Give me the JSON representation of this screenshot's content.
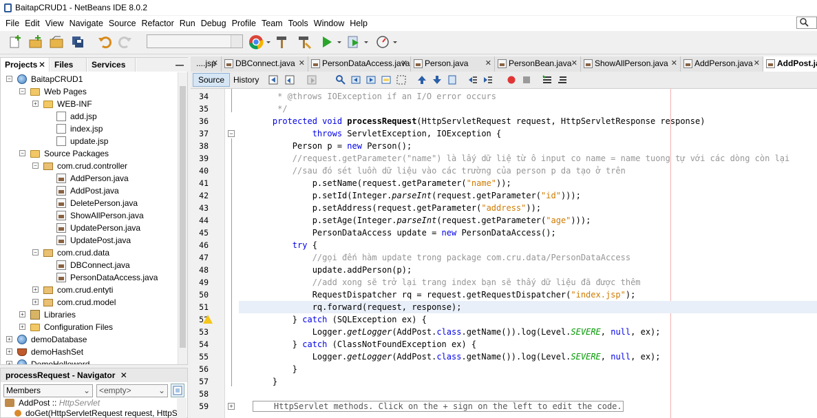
{
  "window": {
    "title": "BaitapCRUD1 - NetBeans IDE 8.0.2"
  },
  "menu": [
    "File",
    "Edit",
    "View",
    "Navigate",
    "Source",
    "Refactor",
    "Run",
    "Debug",
    "Profile",
    "Team",
    "Tools",
    "Window",
    "Help"
  ],
  "search": {
    "icon": "search-icon"
  },
  "panel_tabs": {
    "projects": "Projects",
    "files": "Files",
    "services": "Services",
    "minimize": "—",
    "close": "✕"
  },
  "tree": [
    {
      "label": "BaitapCRUD1",
      "icon": "globe-icon",
      "toggle": "−"
    },
    {
      "label": "Web Pages",
      "icon": "folder-icon",
      "toggle": "−"
    },
    {
      "label": "WEB-INF",
      "icon": "folder-icon",
      "toggle": "+"
    },
    {
      "label": "add.jsp",
      "icon": "jsp-icon",
      "toggle": ""
    },
    {
      "label": "index.jsp",
      "icon": "jsp-icon",
      "toggle": ""
    },
    {
      "label": "update.jsp",
      "icon": "jsp-icon",
      "toggle": ""
    },
    {
      "label": "Source Packages",
      "icon": "folder-icon",
      "toggle": "−"
    },
    {
      "label": "com.crud.controller",
      "icon": "package-icon",
      "toggle": "−"
    },
    {
      "label": "AddPerson.java",
      "icon": "java-icon",
      "toggle": ""
    },
    {
      "label": "AddPost.java",
      "icon": "java-icon",
      "toggle": ""
    },
    {
      "label": "DeletePerson.java",
      "icon": "java-icon",
      "toggle": ""
    },
    {
      "label": "ShowAllPerson.java",
      "icon": "java-icon",
      "toggle": ""
    },
    {
      "label": "UpdatePerson.java",
      "icon": "java-icon",
      "toggle": ""
    },
    {
      "label": "UpdatePost.java",
      "icon": "java-icon",
      "toggle": ""
    },
    {
      "label": "com.crud.data",
      "icon": "package-icon",
      "toggle": "−"
    },
    {
      "label": "DBConnect.java",
      "icon": "java-icon",
      "toggle": ""
    },
    {
      "label": "PersonDataAccess.java",
      "icon": "java-icon",
      "toggle": ""
    },
    {
      "label": "com.crud.entyti",
      "icon": "package-icon",
      "toggle": "+"
    },
    {
      "label": "com.crud.model",
      "icon": "package-icon",
      "toggle": "+"
    },
    {
      "label": "Libraries",
      "icon": "library-icon",
      "toggle": "+"
    },
    {
      "label": "Configuration Files",
      "icon": "folder-icon",
      "toggle": "+"
    },
    {
      "label": "demoDatabase",
      "icon": "globe-icon",
      "toggle": "+"
    },
    {
      "label": "demoHashSet",
      "icon": "coffee-cup-icon",
      "toggle": "+"
    },
    {
      "label": "DemoHelloword",
      "icon": "globe-icon",
      "toggle": "+"
    }
  ],
  "navigator": {
    "title": "processRequest - Navigator",
    "close": "✕",
    "members_select": "Members",
    "filter_select": "<empty>",
    "items": [
      {
        "name": "AddPost",
        "sep": " :: ",
        "type": "HttpServlet"
      },
      {
        "name": "doGet",
        "params": "(HttpServletRequest request, HttpSe"
      }
    ]
  },
  "editor_tabs": [
    {
      "label": "....jsp",
      "close": "✕"
    },
    {
      "label": "DBConnect.java",
      "close": "✕"
    },
    {
      "label": "PersonDataAccess.java",
      "close": "✕"
    },
    {
      "label": "Person.java",
      "close": "✕"
    },
    {
      "label": "PersonBean.java",
      "close": "✕"
    },
    {
      "label": "ShowAllPerson.java",
      "close": "✕"
    },
    {
      "label": "AddPerson.java",
      "close": "✕"
    },
    {
      "label": "AddPost.java",
      "close": ""
    }
  ],
  "editor_modes": {
    "source": "Source",
    "history": "History"
  },
  "code": {
    "line_numbers": [
      "34",
      "35",
      "36",
      "37",
      "38",
      "39",
      "40",
      "41",
      "42",
      "43",
      "44",
      "45",
      "46",
      "47",
      "48",
      "49",
      "50",
      "51",
      "52",
      "53",
      "54",
      "55",
      "56",
      "57",
      "58",
      "59"
    ],
    "current_line": "51",
    "lines": [
      [
        {
          "t": "     * @throws IOException if an I/O error occurs",
          "c": "cm"
        }
      ],
      [
        {
          "t": "     */",
          "c": "cm"
        }
      ],
      [
        {
          "t": "    protected void",
          "c": "kw"
        },
        {
          "t": " processRequest",
          "c": "b"
        },
        {
          "t": "(HttpServletRequest request, HttpServletResponse response)",
          "c": ""
        }
      ],
      [
        {
          "t": "            throws",
          "c": "kw"
        },
        {
          "t": " ServletException, IOException {",
          "c": ""
        }
      ],
      [
        {
          "t": "        Person p = ",
          "c": ""
        },
        {
          "t": "new",
          "c": "kw"
        },
        {
          "t": " Person();",
          "c": ""
        }
      ],
      [
        {
          "t": "        //request.getParameter(\"name\") là lấy dữ liệ từ ô input co name = name tuong tự với các dòng còn lại",
          "c": "cm"
        }
      ],
      [
        {
          "t": "        //sau đó sét luồn dữ liệu vào các trường của person p da tạo ở trên",
          "c": "cm"
        }
      ],
      [
        {
          "t": "            p.setName(request.getParameter(",
          "c": ""
        },
        {
          "t": "\"name\"",
          "c": "str"
        },
        {
          "t": "));",
          "c": ""
        }
      ],
      [
        {
          "t": "            p.setId(Integer.",
          "c": ""
        },
        {
          "t": "parseInt",
          "c": "it"
        },
        {
          "t": "(request.getParameter(",
          "c": ""
        },
        {
          "t": "\"id\"",
          "c": "str"
        },
        {
          "t": ")));",
          "c": ""
        }
      ],
      [
        {
          "t": "            p.setAddress(request.getParameter(",
          "c": ""
        },
        {
          "t": "\"address\"",
          "c": "str"
        },
        {
          "t": "));",
          "c": ""
        }
      ],
      [
        {
          "t": "            p.setAge(Integer.",
          "c": ""
        },
        {
          "t": "parseInt",
          "c": "it"
        },
        {
          "t": "(request.getParameter(",
          "c": ""
        },
        {
          "t": "\"age\"",
          "c": "str"
        },
        {
          "t": ")));",
          "c": ""
        }
      ],
      [
        {
          "t": "            PersonDataAccess update = ",
          "c": ""
        },
        {
          "t": "new",
          "c": "kw"
        },
        {
          "t": " PersonDataAccess();",
          "c": ""
        }
      ],
      [
        {
          "t": "        try",
          "c": "kw"
        },
        {
          "t": " {",
          "c": ""
        }
      ],
      [
        {
          "t": "            //gọi đến hàm update trong package com.cru.data/PersonDataAccess",
          "c": "cm"
        }
      ],
      [
        {
          "t": "            update.addPerson(p);",
          "c": ""
        }
      ],
      [
        {
          "t": "            //add xong sẽ trở lại trang index bạn sẽ thấy dữ liệu đã được thêm",
          "c": "cm"
        }
      ],
      [
        {
          "t": "            RequestDispatcher rq = request.getRequestDispatcher(",
          "c": ""
        },
        {
          "t": "\"index.jsp\"",
          "c": "str"
        },
        {
          "t": ");",
          "c": ""
        }
      ],
      [
        {
          "t": "            rq.forward(request, response);",
          "c": ""
        }
      ],
      [
        {
          "t": "        } ",
          "c": ""
        },
        {
          "t": "catch",
          "c": "kw"
        },
        {
          "t": " (SQLException ex) {",
          "c": ""
        }
      ],
      [
        {
          "t": "            Logger.",
          "c": ""
        },
        {
          "t": "getLogger",
          "c": "it"
        },
        {
          "t": "(AddPost.",
          "c": ""
        },
        {
          "t": "class",
          "c": "kw"
        },
        {
          "t": ".getName()).log(Level.",
          "c": ""
        },
        {
          "t": "SEVERE",
          "c": "fld"
        },
        {
          "t": ", ",
          "c": ""
        },
        {
          "t": "null",
          "c": "kw"
        },
        {
          "t": ", ex);",
          "c": ""
        }
      ],
      [
        {
          "t": "        } ",
          "c": ""
        },
        {
          "t": "catch",
          "c": "kw"
        },
        {
          "t": " (ClassNotFoundException ex) {",
          "c": ""
        }
      ],
      [
        {
          "t": "            Logger.",
          "c": ""
        },
        {
          "t": "getLogger",
          "c": "it"
        },
        {
          "t": "(AddPost.",
          "c": ""
        },
        {
          "t": "class",
          "c": "kw"
        },
        {
          "t": ".getName()).log(Level.",
          "c": ""
        },
        {
          "t": "SEVERE",
          "c": "fld"
        },
        {
          "t": ", ",
          "c": ""
        },
        {
          "t": "null",
          "c": "kw"
        },
        {
          "t": ", ex);",
          "c": ""
        }
      ],
      [
        {
          "t": "        }",
          "c": ""
        }
      ],
      [
        {
          "t": "    }",
          "c": ""
        }
      ],
      [
        {
          "t": "",
          "c": ""
        }
      ],
      [
        {
          "t": "    HttpServlet methods. Click on the + sign on the left to edit the code.",
          "c": "box"
        }
      ]
    ]
  }
}
